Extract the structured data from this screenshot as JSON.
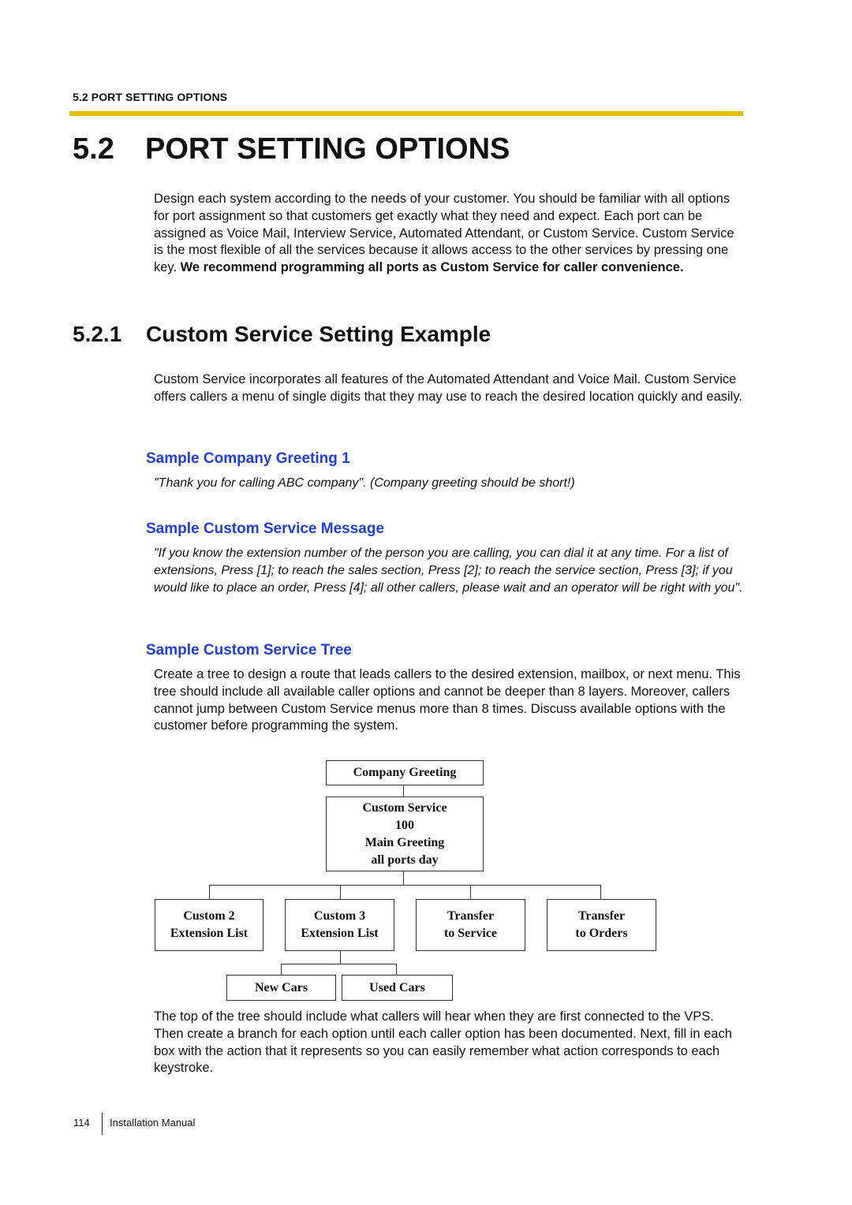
{
  "running_head": "5.2 PORT SETTING OPTIONS",
  "section": {
    "number": "5.2",
    "title": "PORT SETTING OPTIONS",
    "intro_text": "Design each system according to the needs of your customer. You should be familiar with all options for port assignment so that customers get exactly what they need and expect. Each port can be assigned as Voice Mail, Interview Service, Automated Attendant, or Custom Service. Custom Service is the most flexible of all the services because it allows access to the other services by pressing one key. ",
    "intro_bold": "We recommend programming all ports as Custom Service for caller convenience."
  },
  "subsection": {
    "number": "5.2.1",
    "title": "Custom Service Setting Example",
    "text": "Custom Service incorporates all features of the Automated Attendant and Voice Mail. Custom Service offers callers a menu of single digits that they may use to reach the desired location quickly and easily."
  },
  "greeting": {
    "heading": "Sample Company Greeting 1",
    "quote": "\"Thank you for calling ABC company\". (Company greeting should be short!)"
  },
  "message": {
    "heading": "Sample Custom Service Message",
    "quote": "\"If you know the extension number of the person you are calling, you can dial it at any time. For a list of extensions, Press [1]; to reach the sales section, Press [2]; to reach the service section, Press [3]; if you would like to place an order, Press [4]; all other callers, please wait and an operator will be right with you\"."
  },
  "tree": {
    "heading": "Sample Custom Service Tree",
    "text": "Create a tree to design a route that leads callers to the desired extension, mailbox, or next menu. This tree should include all available caller options and cannot be deeper than 8 layers. Moreover, callers cannot jump between Custom Service menus more than 8 times. Discuss available options with the customer before programming the system.",
    "root": "Company Greeting",
    "main": [
      "Custom Service",
      "100",
      "Main Greeting",
      "all ports day"
    ],
    "children": [
      [
        "Custom 2",
        "Extension List"
      ],
      [
        "Custom 3",
        "Extension List"
      ],
      [
        "Transfer",
        "to Service"
      ],
      [
        "Transfer",
        "to Orders"
      ]
    ],
    "grandchildren": [
      "New Cars",
      "Used Cars"
    ],
    "closing_text": "The top of the tree should include what callers will hear when they are first connected to the VPS. Then create a branch for each option until each caller option has been documented. Next, fill in each box with the action that it represents so you can easily remember what action corresponds to each keystroke."
  },
  "footer": {
    "page_number": "114",
    "title": "Installation Manual"
  }
}
